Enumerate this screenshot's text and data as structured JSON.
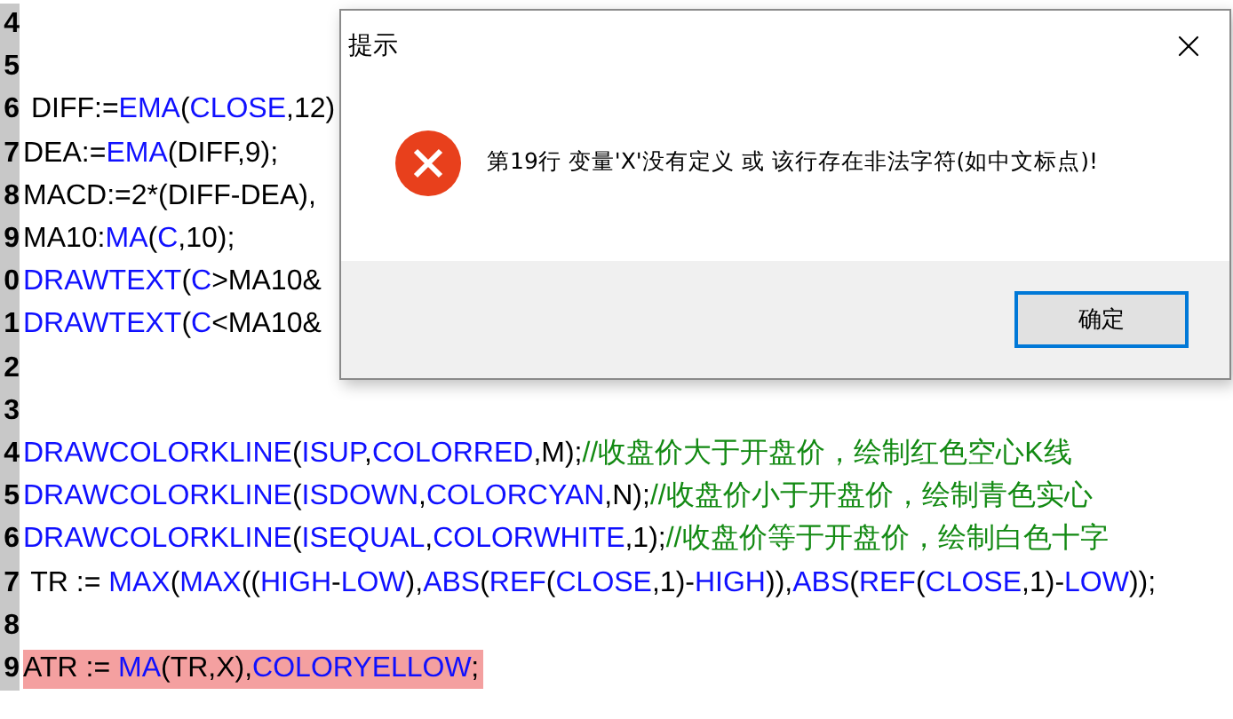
{
  "editor": {
    "lines": [
      {
        "number": "4",
        "highlight": false
      },
      {
        "number": "5",
        "highlight": false
      },
      {
        "number": "6",
        "highlight": false,
        "tokens": [
          {
            "text": " DIFF:=",
            "kind": "plain"
          },
          {
            "text": "EMA",
            "kind": "keyword"
          },
          {
            "text": "(",
            "kind": "plain"
          },
          {
            "text": "CLOSE",
            "kind": "keyword"
          },
          {
            "text": ",12)",
            "kind": "plain"
          }
        ]
      },
      {
        "number": "7",
        "highlight": false,
        "tokens": [
          {
            "text": "DEA:=",
            "kind": "plain"
          },
          {
            "text": "EMA",
            "kind": "keyword"
          },
          {
            "text": "(DIFF,9);",
            "kind": "plain"
          }
        ]
      },
      {
        "number": "8",
        "highlight": false,
        "tokens": [
          {
            "text": "MACD:=2*(DIFF-DEA),",
            "kind": "plain"
          }
        ]
      },
      {
        "number": "9",
        "highlight": false,
        "tokens": [
          {
            "text": "MA10:",
            "kind": "plain"
          },
          {
            "text": "MA",
            "kind": "keyword"
          },
          {
            "text": "(",
            "kind": "plain"
          },
          {
            "text": "C",
            "kind": "keyword"
          },
          {
            "text": ",10);",
            "kind": "plain"
          }
        ]
      },
      {
        "number": "0",
        "highlight": false,
        "tokens": [
          {
            "text": "DRAWTEXT",
            "kind": "keyword"
          },
          {
            "text": "(",
            "kind": "plain"
          },
          {
            "text": "C",
            "kind": "keyword"
          },
          {
            "text": ">MA10&",
            "kind": "plain"
          }
        ]
      },
      {
        "number": "1",
        "highlight": false,
        "tokens": [
          {
            "text": "DRAWTEXT",
            "kind": "keyword"
          },
          {
            "text": "(",
            "kind": "plain"
          },
          {
            "text": "C",
            "kind": "keyword"
          },
          {
            "text": "<MA10&",
            "kind": "plain"
          }
        ]
      },
      {
        "number": "2",
        "highlight": false
      },
      {
        "number": "3",
        "highlight": false
      },
      {
        "number": "4",
        "highlight": false,
        "tokens": [
          {
            "text": "DRAWCOLORKLINE",
            "kind": "keyword"
          },
          {
            "text": "(",
            "kind": "plain"
          },
          {
            "text": "ISUP",
            "kind": "keyword"
          },
          {
            "text": ",",
            "kind": "plain"
          },
          {
            "text": "COLORRED",
            "kind": "keyword"
          },
          {
            "text": ",M);",
            "kind": "plain"
          },
          {
            "text": "//收盘价大于开盘价，绘制红色空心K线",
            "kind": "comment"
          }
        ]
      },
      {
        "number": "5",
        "highlight": false,
        "tokens": [
          {
            "text": "DRAWCOLORKLINE",
            "kind": "keyword"
          },
          {
            "text": "(",
            "kind": "plain"
          },
          {
            "text": "ISDOWN",
            "kind": "keyword"
          },
          {
            "text": ",",
            "kind": "plain"
          },
          {
            "text": "COLORCYAN",
            "kind": "keyword"
          },
          {
            "text": ",N);",
            "kind": "plain"
          },
          {
            "text": "//收盘价小于开盘价，绘制青色实心",
            "kind": "comment"
          }
        ]
      },
      {
        "number": "6",
        "highlight": false,
        "tokens": [
          {
            "text": "DRAWCOLORKLINE",
            "kind": "keyword"
          },
          {
            "text": "(",
            "kind": "plain"
          },
          {
            "text": "ISEQUAL",
            "kind": "keyword"
          },
          {
            "text": ",",
            "kind": "plain"
          },
          {
            "text": "COLORWHITE",
            "kind": "keyword"
          },
          {
            "text": ",1);",
            "kind": "plain"
          },
          {
            "text": "//收盘价等于开盘价，绘制白色十字",
            "kind": "comment"
          }
        ]
      },
      {
        "number": "7",
        "highlight": false,
        "tokens": [
          {
            "text": " TR := ",
            "kind": "plain"
          },
          {
            "text": "MAX",
            "kind": "keyword"
          },
          {
            "text": "(",
            "kind": "plain"
          },
          {
            "text": "MAX",
            "kind": "keyword"
          },
          {
            "text": "((",
            "kind": "plain"
          },
          {
            "text": "HIGH",
            "kind": "keyword"
          },
          {
            "text": "-",
            "kind": "plain"
          },
          {
            "text": "LOW",
            "kind": "keyword"
          },
          {
            "text": "),",
            "kind": "plain"
          },
          {
            "text": "ABS",
            "kind": "keyword"
          },
          {
            "text": "(",
            "kind": "plain"
          },
          {
            "text": "REF",
            "kind": "keyword"
          },
          {
            "text": "(",
            "kind": "plain"
          },
          {
            "text": "CLOSE",
            "kind": "keyword"
          },
          {
            "text": ",1)-",
            "kind": "plain"
          },
          {
            "text": "HIGH",
            "kind": "keyword"
          },
          {
            "text": ")),",
            "kind": "plain"
          },
          {
            "text": "ABS",
            "kind": "keyword"
          },
          {
            "text": "(",
            "kind": "plain"
          },
          {
            "text": "REF",
            "kind": "keyword"
          },
          {
            "text": "(",
            "kind": "plain"
          },
          {
            "text": "CLOSE",
            "kind": "keyword"
          },
          {
            "text": ",1)-",
            "kind": "plain"
          },
          {
            "text": "LOW",
            "kind": "keyword"
          },
          {
            "text": "));",
            "kind": "plain"
          }
        ]
      },
      {
        "number": "8",
        "highlight": false
      },
      {
        "number": "9",
        "highlight": true,
        "tokens": [
          {
            "text": "ATR := ",
            "kind": "plain"
          },
          {
            "text": "MA",
            "kind": "keyword"
          },
          {
            "text": "(TR,X),",
            "kind": "plain"
          },
          {
            "text": "COLORYELLOW",
            "kind": "keyword"
          },
          {
            "text": ";",
            "kind": "plain"
          }
        ]
      }
    ]
  },
  "dialog": {
    "title": "提示",
    "message": "第19行 变量'X'没有定义 或 该行存在非法字符(如中文标点)!",
    "buttons": [
      {
        "label": "确定",
        "focused": true
      }
    ]
  }
}
